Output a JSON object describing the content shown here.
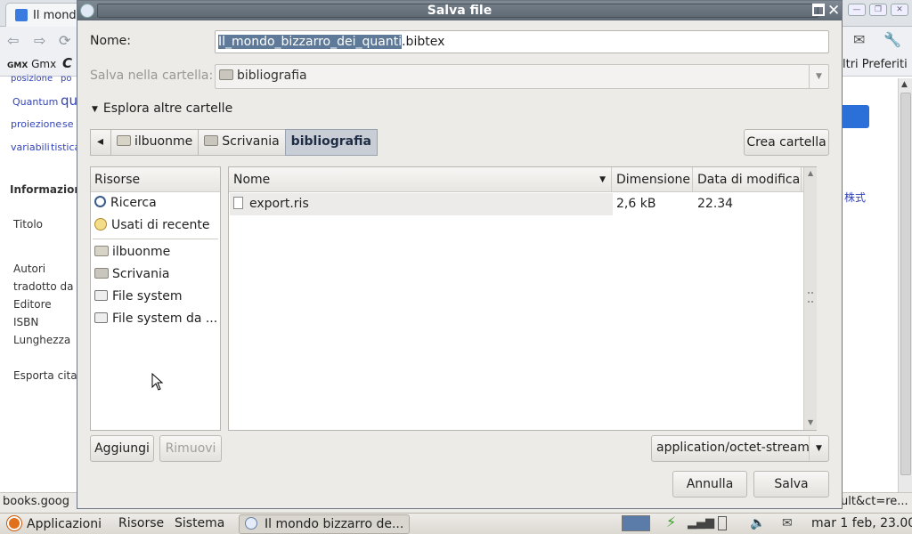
{
  "browser": {
    "tab_title": "Il mondo",
    "bookmarks": {
      "gmx": "Gmx",
      "c": "C",
      "other": "ltri Preferiti"
    },
    "sidebar_words": {
      "posizione": "posizione",
      "po": "po",
      "quantum": "Quantum",
      "qu": "qu",
      "proiezione": "proiezione",
      "se": "se",
      "variabili": "variabili",
      "tistica": "tistica"
    },
    "info_heading": "Informazion",
    "labels": {
      "titolo": "Titolo",
      "autori": "Autori",
      "tradotto": "tradotto da",
      "editore": "Editore",
      "isbn": "ISBN",
      "lunghezza": "Lunghezza",
      "esporta": "Esporta cita"
    },
    "right_link": "株式",
    "status_left": "books.goog",
    "status_right": "ult&ct=re..."
  },
  "dialog": {
    "title": "Salva file",
    "name_label": "Nome:",
    "filename_selected": "Il_mondo_bizzarro_dei_quanti",
    "filename_ext": ".bibtex",
    "folder_label": "Salva nella cartella:",
    "folder_value": "bibliografia",
    "expander_label": "Esplora altre cartelle",
    "path": {
      "back": "◂",
      "items": [
        "ilbuonme",
        "Scrivania",
        "bibliografia"
      ]
    },
    "create_folder": "Crea cartella",
    "places": {
      "header": "Risorse",
      "items": [
        "Ricerca",
        "Usati di recente",
        "ilbuonme",
        "Scrivania",
        "File system",
        "File system da ..."
      ]
    },
    "files": {
      "columns": [
        "Nome",
        "Dimensione",
        "Data di modifica"
      ],
      "rows": [
        {
          "name": "export.ris",
          "size": "2,6 kB",
          "date": "22.34"
        }
      ]
    },
    "add_button": "Aggiungi",
    "remove_button": "Rimuovi",
    "filter_value": "application/octet-stream",
    "cancel_button": "Annulla",
    "save_button": "Salva"
  },
  "panel": {
    "applicazioni": "Applicazioni",
    "risorse": "Risorse",
    "sistema": "Sistema",
    "task_title": "Il mondo bizzarro de...",
    "clock": "mar  1 feb, 23.00"
  }
}
